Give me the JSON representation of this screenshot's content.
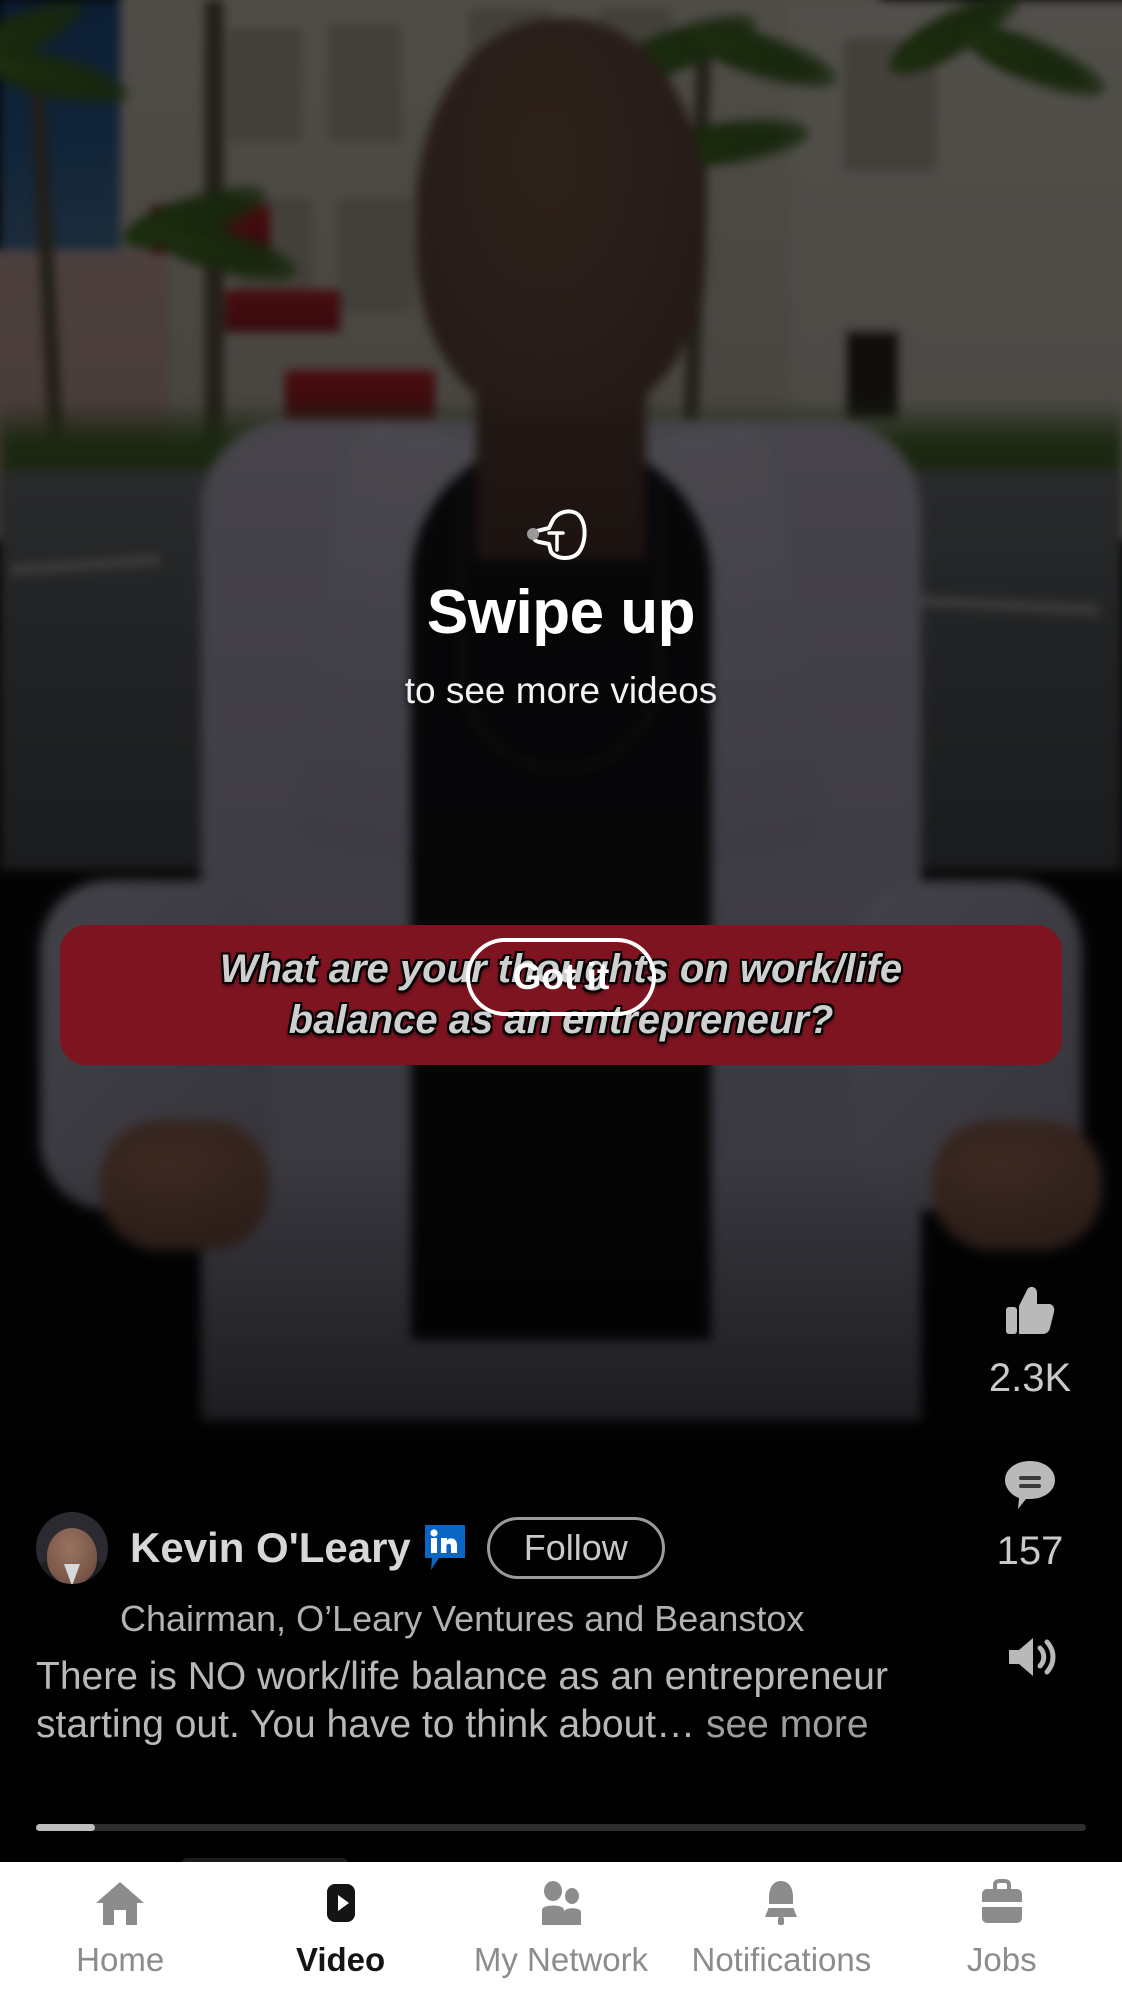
{
  "video": {
    "coach_mark": {
      "hand_icon": "swipe-hand-icon",
      "title": "Swipe up",
      "subtitle": "to see more videos",
      "dismiss_label": "Got it"
    },
    "caption": {
      "line1": "What are your thoughts on work/life",
      "line2": "balance as an entrepreneur?",
      "background_color": "#7e1420",
      "text_color": "#cfcfcf"
    },
    "actions": [
      {
        "icon": "thumbs-up-icon",
        "name": "like",
        "count": "2.3K"
      },
      {
        "icon": "comment-icon",
        "name": "comment",
        "count": "157"
      },
      {
        "icon": "volume-on-icon",
        "name": "sound",
        "count": ""
      }
    ],
    "author": {
      "avatar_icon": "avatar",
      "name": "Kevin O'Leary",
      "verified_badge_icon": "linkedin-badge-icon",
      "follow_label": "Follow",
      "headline": "Chairman, O’Leary Ventures and Beanstox"
    },
    "description": {
      "text": "There is NO work/life balance as an entrepreneur starting out. You have to think about… ",
      "see_more_label": "see more"
    },
    "progress": {
      "percent": 5.6
    }
  },
  "bottom_nav": {
    "items": [
      {
        "icon": "home-icon",
        "label": "Home",
        "active": false
      },
      {
        "icon": "video-icon",
        "label": "Video",
        "active": true
      },
      {
        "icon": "my-network-icon",
        "label": "My Network",
        "active": false
      },
      {
        "icon": "notifications-icon",
        "label": "Notifications",
        "active": false
      },
      {
        "icon": "jobs-icon",
        "label": "Jobs",
        "active": false
      }
    ]
  }
}
